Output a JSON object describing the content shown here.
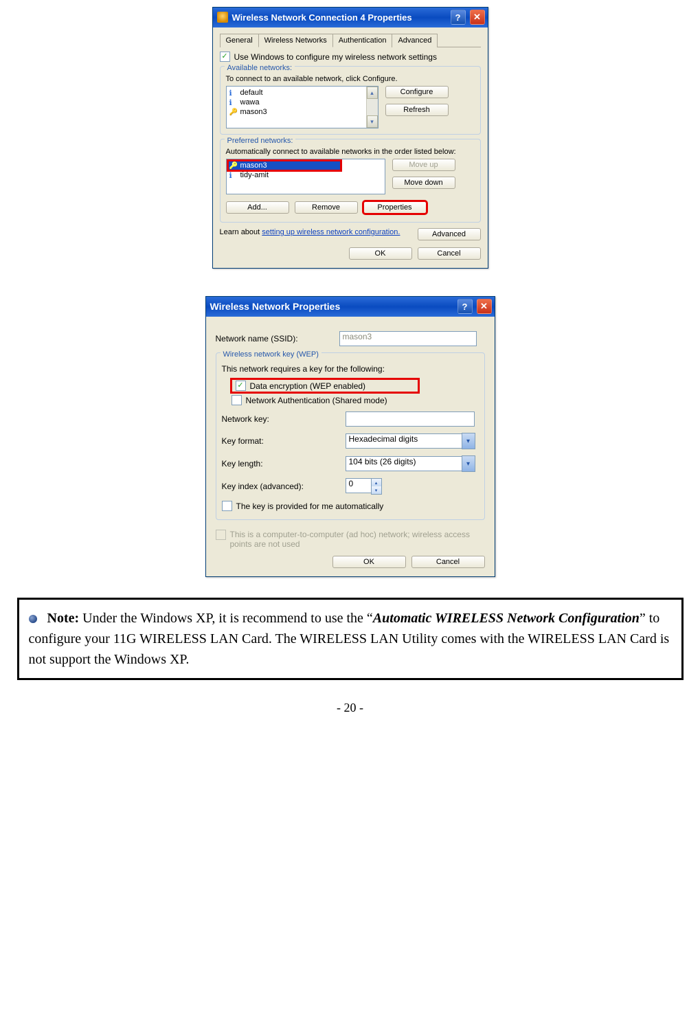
{
  "dialog1": {
    "title": "Wireless Network Connection 4 Properties",
    "tabs": [
      "General",
      "Wireless Networks",
      "Authentication",
      "Advanced"
    ],
    "active_tab_index": 1,
    "use_windows_label": "Use Windows to configure my wireless network settings",
    "avail": {
      "legend": "Available networks:",
      "hint": "To connect to an available network, click Configure.",
      "items": [
        "default",
        "wawa",
        "mason3"
      ],
      "btn_configure": "Configure",
      "btn_refresh": "Refresh"
    },
    "pref": {
      "legend": "Preferred networks:",
      "hint": "Automatically connect to available networks in the order listed below:",
      "items": [
        "mason3",
        "tidy-amit"
      ],
      "selected_index": 0,
      "btn_move_up": "Move up",
      "btn_move_down": "Move down",
      "btn_add": "Add...",
      "btn_remove": "Remove",
      "btn_properties": "Properties"
    },
    "learn_prefix": "Learn about ",
    "learn_link": "setting up wireless network configuration.",
    "btn_advanced": "Advanced",
    "btn_ok": "OK",
    "btn_cancel": "Cancel"
  },
  "dialog2": {
    "title": "Wireless Network Properties",
    "ssid_label": "Network name (SSID):",
    "ssid_value": "mason3",
    "wep": {
      "legend": "Wireless network key (WEP)",
      "requires": "This network requires a key for the following:",
      "enc_label": "Data encryption (WEP enabled)",
      "auth_label": "Network Authentication (Shared mode)",
      "key_label": "Network key:",
      "key_value": "",
      "fmt_label": "Key format:",
      "fmt_value": "Hexadecimal digits",
      "len_label": "Key length:",
      "len_value": "104 bits (26 digits)",
      "idx_label": "Key index (advanced):",
      "idx_value": "0",
      "auto_label": "The key is provided for me automatically"
    },
    "adhoc_label": "This is a computer-to-computer (ad hoc) network; wireless access points are not used",
    "btn_ok": "OK",
    "btn_cancel": "Cancel"
  },
  "note": {
    "label": "Note:",
    "t1": " Under the Windows XP, it is recommend to use the “",
    "em": "Automatic WIRELESS Network Configuration",
    "t2": "” to configure your 11G WIRELESS LAN Card. The WIRELESS LAN Utility comes with the WIRELESS LAN Card is not support the Windows XP."
  },
  "page_number": "- 20 -"
}
